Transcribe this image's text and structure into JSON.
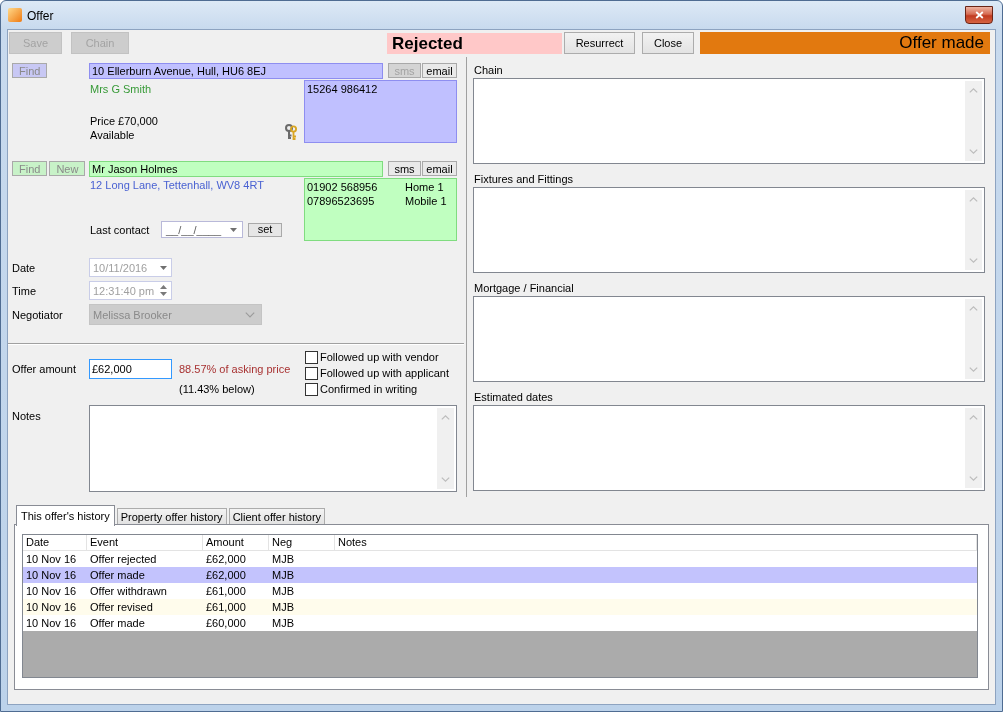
{
  "window": {
    "title": "Offer"
  },
  "toolbar": {
    "buttons": [
      {
        "label": "Save",
        "disabled": true
      },
      {
        "label": "Chain",
        "disabled": true
      }
    ],
    "status": {
      "label": "Rejected"
    },
    "actions": [
      {
        "label": "Resurrect",
        "disabled": false
      },
      {
        "label": "Close",
        "disabled": false
      }
    ],
    "stage": {
      "label": "Offer made"
    }
  },
  "property": {
    "buttons": [
      {
        "label": "Find",
        "disabled": true
      }
    ],
    "address": "10 Ellerburn Avenue, Hull, HU6 8EJ",
    "sms": {
      "label": "sms",
      "disabled": true
    },
    "email": {
      "label": "email",
      "disabled": false
    },
    "vendor": "Mrs G Smith",
    "price": "Price £70,000",
    "availability": "Available",
    "phones": [
      {
        "number": "15264 986412"
      }
    ]
  },
  "applicant": {
    "buttons": [
      {
        "label": "Find",
        "disabled": true
      },
      {
        "label": "New",
        "disabled": true
      }
    ],
    "name": "Mr Jason Holmes",
    "sms": {
      "label": "sms",
      "disabled": false
    },
    "email": {
      "label": "email",
      "disabled": false
    },
    "address": "12 Long Lane, Tettenhall, WV8 4RT",
    "phones": [
      {
        "number": "01902 568956",
        "type": "Home 1"
      },
      {
        "number": "07896523695",
        "type": "Mobile 1"
      }
    ],
    "last_contact": {
      "label": "Last contact",
      "placeholder": "__/__/____",
      "button": "set"
    }
  },
  "details": {
    "date": {
      "label": "Date",
      "value": "10/11/2016",
      "disabled": true
    },
    "time": {
      "label": "Time",
      "value": "12:31:40 pm",
      "disabled": true
    },
    "negotiator": {
      "label": "Negotiator",
      "value": "Melissa Brooker",
      "disabled": true
    }
  },
  "offer": {
    "label": "Offer amount",
    "value": "£62,000",
    "focused": true,
    "ratio": "88.57% of asking price",
    "difference": "(11.43% below)",
    "checks": [
      {
        "label": "Followed up with vendor",
        "checked": false
      },
      {
        "label": "Followed up with applicant",
        "checked": false
      },
      {
        "label": "Confirmed in writing",
        "checked": false
      }
    ]
  },
  "notes": {
    "label": "Notes"
  },
  "memos": [
    {
      "label": "Chain"
    },
    {
      "label": "Fixtures and Fittings"
    },
    {
      "label": "Mortgage / Financial"
    },
    {
      "label": "Estimated dates"
    }
  ],
  "history": {
    "tabs": [
      {
        "label": "This offer's history",
        "selected": true
      },
      {
        "label": "Property offer history",
        "selected": false
      },
      {
        "label": "Client offer history",
        "selected": false
      }
    ],
    "columns": [
      "Date",
      "Event",
      "Amount",
      "Neg",
      "Notes"
    ],
    "rows": [
      {
        "date": "10 Nov 16",
        "event": "Offer rejected",
        "amount": "£62,000",
        "neg": "MJB",
        "selected": false,
        "color": "#ffffff"
      },
      {
        "date": "10 Nov 16",
        "event": "Offer made",
        "amount": "£62,000",
        "neg": "MJB",
        "selected": true
      },
      {
        "date": "10 Nov 16",
        "event": "Offer withdrawn",
        "amount": "£61,000",
        "neg": "MJB",
        "selected": false,
        "color": "#ffffff"
      },
      {
        "date": "10 Nov 16",
        "event": "Offer revised",
        "amount": "£61,000",
        "neg": "MJB",
        "selected": false,
        "color": "#fffcec"
      },
      {
        "date": "10 Nov 16",
        "event": "Offer made",
        "amount": "£60,000",
        "neg": "MJB",
        "selected": false,
        "color": "#ffffff"
      }
    ]
  }
}
